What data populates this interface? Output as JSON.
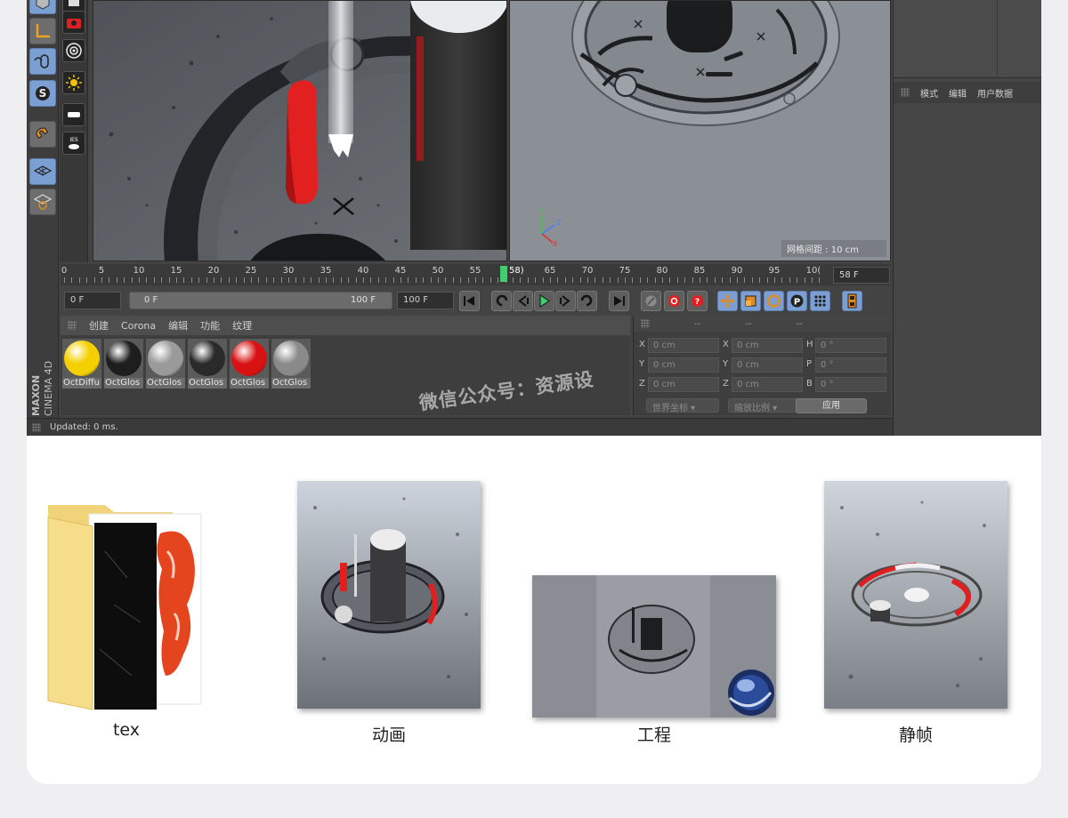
{
  "viewport": {
    "grid_spacing": "网格间距 : 10 cm",
    "axis": {
      "y": "Y",
      "z": "Z",
      "x": "X"
    }
  },
  "attributes_menu": [
    "模式",
    "编辑",
    "用户数据"
  ],
  "timeline": {
    "ticks": [
      "0",
      "5",
      "10",
      "15",
      "20",
      "25",
      "30",
      "35",
      "40",
      "45",
      "50",
      "55",
      "65",
      "70",
      "75",
      "80",
      "85",
      "90",
      "95",
      "10("
    ],
    "current_label": "58)",
    "current_frame_field": "58 F"
  },
  "transport": {
    "start_field": "0 F",
    "range_start": "0 F",
    "range_end": "100 F",
    "end_field": "100 F"
  },
  "material_manager": {
    "menu": [
      "创建",
      "Corona",
      "编辑",
      "功能",
      "纹理"
    ],
    "materials": [
      {
        "name": "OctDiffu",
        "color": "#f5d000"
      },
      {
        "name": "OctGlos",
        "color": "#1e1e1e"
      },
      {
        "name": "OctGlos",
        "color": "#9a9a9a"
      },
      {
        "name": "OctGlos",
        "color": "#2a2a2a"
      },
      {
        "name": "OctGlos",
        "color": "#d81212"
      },
      {
        "name": "OctGlos",
        "color": "#8a8a8a"
      }
    ]
  },
  "coordinates": {
    "header": [
      "--",
      "--",
      "--"
    ],
    "rows": [
      {
        "l1": "X",
        "v1": "0 cm",
        "l2": "X",
        "v2": "0 cm",
        "l3": "H",
        "v3": "0 °"
      },
      {
        "l1": "Y",
        "v1": "0 cm",
        "l2": "Y",
        "v2": "0 cm",
        "l3": "P",
        "v3": "0 °"
      },
      {
        "l1": "Z",
        "v1": "0 cm",
        "l2": "Z",
        "v2": "0 cm",
        "l3": "B",
        "v3": "0 °"
      }
    ],
    "world_dropdown": "世界坐标",
    "scale_dropdown": "缩放比例",
    "apply_label": "应用"
  },
  "status": "Updated: 0 ms.",
  "branding": {
    "line1": "MAXON",
    "line2": "CINEMA 4D"
  },
  "watermark": "微信公众号：资源设",
  "files": [
    {
      "caption": "tex"
    },
    {
      "caption": "动画"
    },
    {
      "caption": "工程"
    },
    {
      "caption": "静帧"
    }
  ],
  "colors": {
    "selected_tool": "#7b9ed3",
    "playhead": "#3fcf6e",
    "accent_red": "#e02020"
  }
}
